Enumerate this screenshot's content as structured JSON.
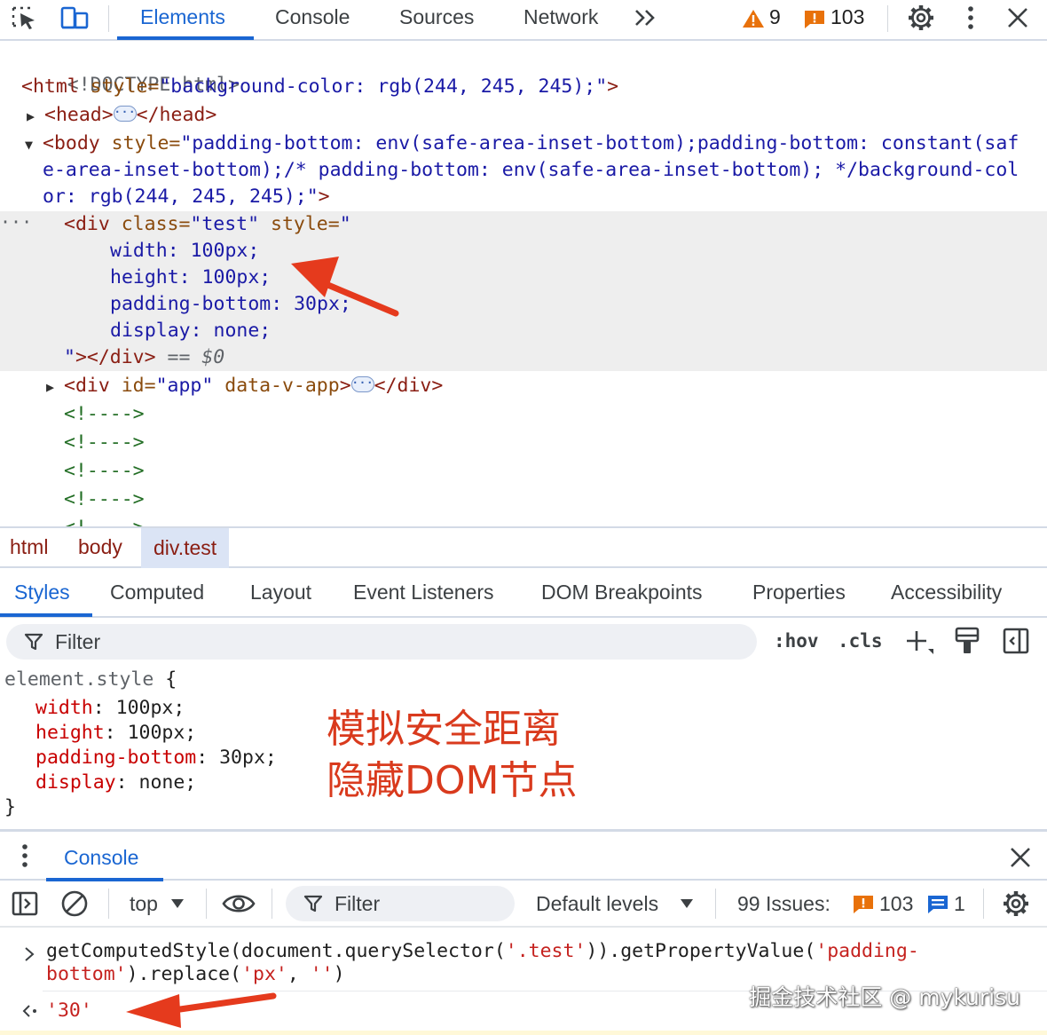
{
  "toolbar": {
    "tabs": [
      "Elements",
      "Console",
      "Sources",
      "Network"
    ],
    "more_label": ">>",
    "warnings_count": "9",
    "errors_count": "103"
  },
  "dom": {
    "lines": {
      "doctype": "<!DOCTYPE html>",
      "html_tag": "<html ",
      "html_attr": "style=",
      "html_val": "\"background-color: rgb(244, 245, 245);\"",
      "html_close": ">",
      "head_open": "<head>",
      "head_close": "</head>",
      "body_tag": "<body ",
      "body_attr": "style=",
      "body_val_1": "\"padding-bottom: env(safe-area-inset-bottom);padding-bottom: constant(saf",
      "body_val_2": "e-area-inset-bottom);/* padding-bottom: env(safe-area-inset-bottom); */background-col",
      "body_val_3": "or: rgb(244, 245, 245);\"",
      "body_close": ">",
      "div_tag": "<div ",
      "div_class_attr": "class=",
      "div_class_val": "\"test\"",
      "div_style_attr": " style=",
      "div_style_open": "\"",
      "style_l1": "width: 100px;",
      "style_l2": "height: 100px;",
      "style_l3": "padding-bottom: 30px;",
      "style_l4": "display: none;",
      "div_end_quote": "\"",
      "div_end_tag": "></div>",
      "selected_marker": " == $0",
      "app_tag": "<div ",
      "app_id_attr": "id=",
      "app_id_val": "\"app\"",
      "app_data_attr": " data-v-app",
      "app_gt": ">",
      "app_close": "</div>",
      "comment": "<!---->"
    }
  },
  "breadcrumb": [
    "html",
    "body",
    "div.test"
  ],
  "styles_tabs": [
    "Styles",
    "Computed",
    "Layout",
    "Event Listeners",
    "DOM Breakpoints",
    "Properties",
    "Accessibility"
  ],
  "filter": {
    "placeholder": "Filter",
    "hov": ":hov",
    "cls": ".cls"
  },
  "rule": {
    "selector": "element.style",
    "open": " {",
    "close": "}",
    "props": [
      {
        "name": "width",
        "value": "100px;"
      },
      {
        "name": "height",
        "value": "100px;"
      },
      {
        "name": "padding-bottom",
        "value": "30px;"
      },
      {
        "name": "display",
        "value": "none;"
      }
    ],
    "annotation_line1": "模拟安全距离",
    "annotation_line2": "隐藏DOM节点"
  },
  "console": {
    "tab": "Console",
    "context": "top",
    "filter_placeholder": "Filter",
    "levels": "Default levels",
    "issues_label": "99 Issues:",
    "issues_errors": "103",
    "issues_info": "1",
    "input_1_a": "getComputedStyle(document.querySelector(",
    "input_1_s1": "'.test'",
    "input_1_b": ")).getPropertyValue(",
    "input_1_s2": "'padding-",
    "input_2_s2": "bottom'",
    "input_2_b": ").replace(",
    "input_2_s3": "'px'",
    "input_2_c": ", ",
    "input_2_s4": "''",
    "input_2_d": ")",
    "output": "'30'",
    "watermark": "掘金技术社区 @ mykurisu"
  },
  "colors": {
    "accent": "#1a66d2",
    "tag": "#8a1e13",
    "attr_name": "#8a4b0d",
    "attr_value": "#1a1aa6",
    "annotation": "#d93a1d"
  }
}
